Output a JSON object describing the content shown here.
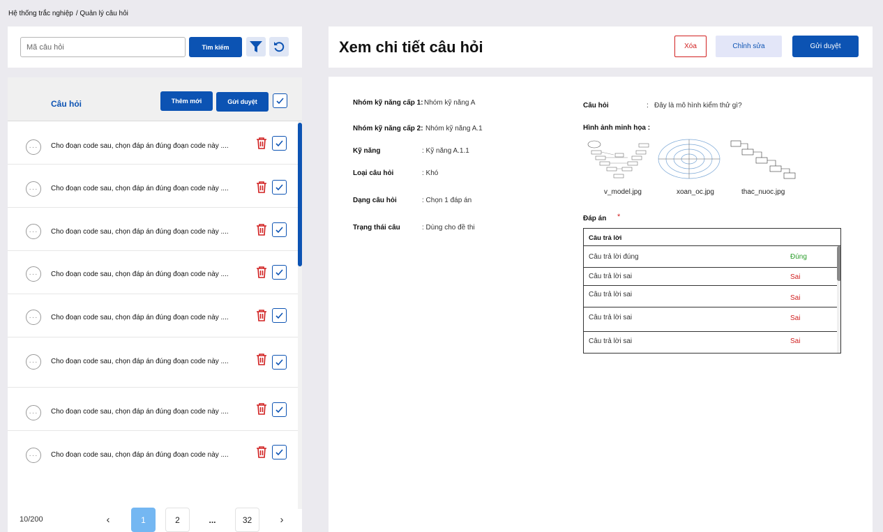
{
  "breadcrumb": {
    "root": "Hệ thống trắc nghiệp",
    "current": "/ Quản lý câu hỏi"
  },
  "search": {
    "placeholder": "Mã câu hỏi",
    "value": "",
    "button_label": "Tìm kiếm",
    "filter_icon": "filter-icon",
    "refresh_icon": "refresh-icon"
  },
  "list": {
    "title": "Câu hỏi",
    "add_label": "Thêm mới",
    "submit_label": "Gửi duyệt",
    "items": [
      {
        "text": "Cho đoạn code sau, chọn đáp án đúng đoạn code này ...."
      },
      {
        "text": "Cho đoạn code sau, chọn đáp án đúng đoạn code này ...."
      },
      {
        "text": "Cho đoạn code sau, chọn đáp án đúng đoạn code này ...."
      },
      {
        "text": "Cho đoạn code sau, chọn đáp án đúng đoạn code này ...."
      },
      {
        "text": "Cho đoạn code sau, chọn đáp án đúng đoạn code này ...."
      },
      {
        "text": "Cho đoạn code sau, chọn đáp án đúng đoạn code này ...."
      },
      {
        "text": "Cho đoạn code sau, chọn đáp án đúng đoạn code này ...."
      },
      {
        "text": "Cho đoạn code sau, chọn đáp án đúng đoạn code này ...."
      }
    ]
  },
  "pagination": {
    "info": "10/200",
    "pages": [
      "1",
      "2",
      "...",
      "32"
    ],
    "active": "1",
    "prev": "‹",
    "next": "›"
  },
  "detail": {
    "title": "Xem chi tiết câu hỏi",
    "delete_label": "Xóa",
    "edit_label": "Chỉnh sửa",
    "submit_label": "Gửi duyệt",
    "fields": [
      {
        "label": "Nhóm kỹ năng cấp 1:",
        "value": "Nhóm kỹ năng A"
      },
      {
        "label": "Nhóm kỹ năng cấp 2:",
        "value": "Nhóm kỹ năng A.1"
      },
      {
        "label": "Kỹ năng",
        "value": ": Kỹ năng A.1.1"
      },
      {
        "label": "Loại câu hỏi",
        "value": ": Khó"
      },
      {
        "label": "Dạng câu hỏi",
        "value": ": Chọn 1 đáp án"
      },
      {
        "label": "Trạng thái câu",
        "value": ": Dùng cho đề thi"
      }
    ],
    "question_label": "Câu hỏi",
    "question_colon": ":",
    "question_value": "Đây là mô hình kiểm thử gì?",
    "images_label": "Hình ảnh minh họa :",
    "images": [
      {
        "name": "v_model.jpg"
      },
      {
        "name": "xoan_oc.jpg"
      },
      {
        "name": "thac_nuoc.jpg"
      }
    ],
    "answers_label": "Đáp án",
    "required_mark": "*",
    "answers_header": "Câu trả lời",
    "answers": [
      {
        "text": "Câu trả lời đúng",
        "status": "Đúng",
        "correct": true
      },
      {
        "text": "Câu trả lời sai",
        "status": "Sai",
        "correct": false
      },
      {
        "text": "Câu trả lời sai",
        "status": "Sai",
        "correct": false
      },
      {
        "text": "Câu trả lời sai",
        "status": "Sai",
        "correct": false
      },
      {
        "text": "Câu trả lời sai",
        "status": "Sai",
        "correct": false
      }
    ]
  },
  "colors": {
    "primary": "#0c53b3",
    "danger": "#d12020",
    "success": "#2a9d2a",
    "active_page": "#74b7f2"
  }
}
